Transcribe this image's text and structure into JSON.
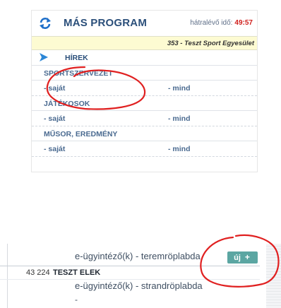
{
  "header": {
    "title": "MÁS PROGRAM",
    "timer_label": "hátralévő idő:",
    "timer_value": "49:57",
    "org": "353 - Teszt Sport Egyesület",
    "icons": {
      "refresh": "refresh-icon",
      "arrow": "arrow-right-icon"
    }
  },
  "menu": [
    {
      "label": "HÍREK",
      "active": true
    },
    {
      "label": "SPORTSZERVEZET"
    },
    {
      "left": "- saját",
      "right": "- mind"
    },
    {
      "label": "JÁTÉKOSOK"
    },
    {
      "left": "- saját",
      "right": "- mind"
    },
    {
      "label": "MŰSOR, EREDMÉNY"
    },
    {
      "left": "- saját",
      "right": "- mind"
    }
  ],
  "bottom": {
    "line1": "e-ügyintéző(k) - teremröplabda",
    "new_label": "új",
    "new_icon": "plus-icon",
    "row_id": "43 224",
    "row_name": "TESZT ELEK",
    "line2": "e-ügyintéző(k) - strandröplabda",
    "line3": "-"
  },
  "colors": {
    "accent": "#2b4f7a",
    "timer": "#d0201d",
    "annotation": "#e02020",
    "button": "#5ba6a2"
  }
}
